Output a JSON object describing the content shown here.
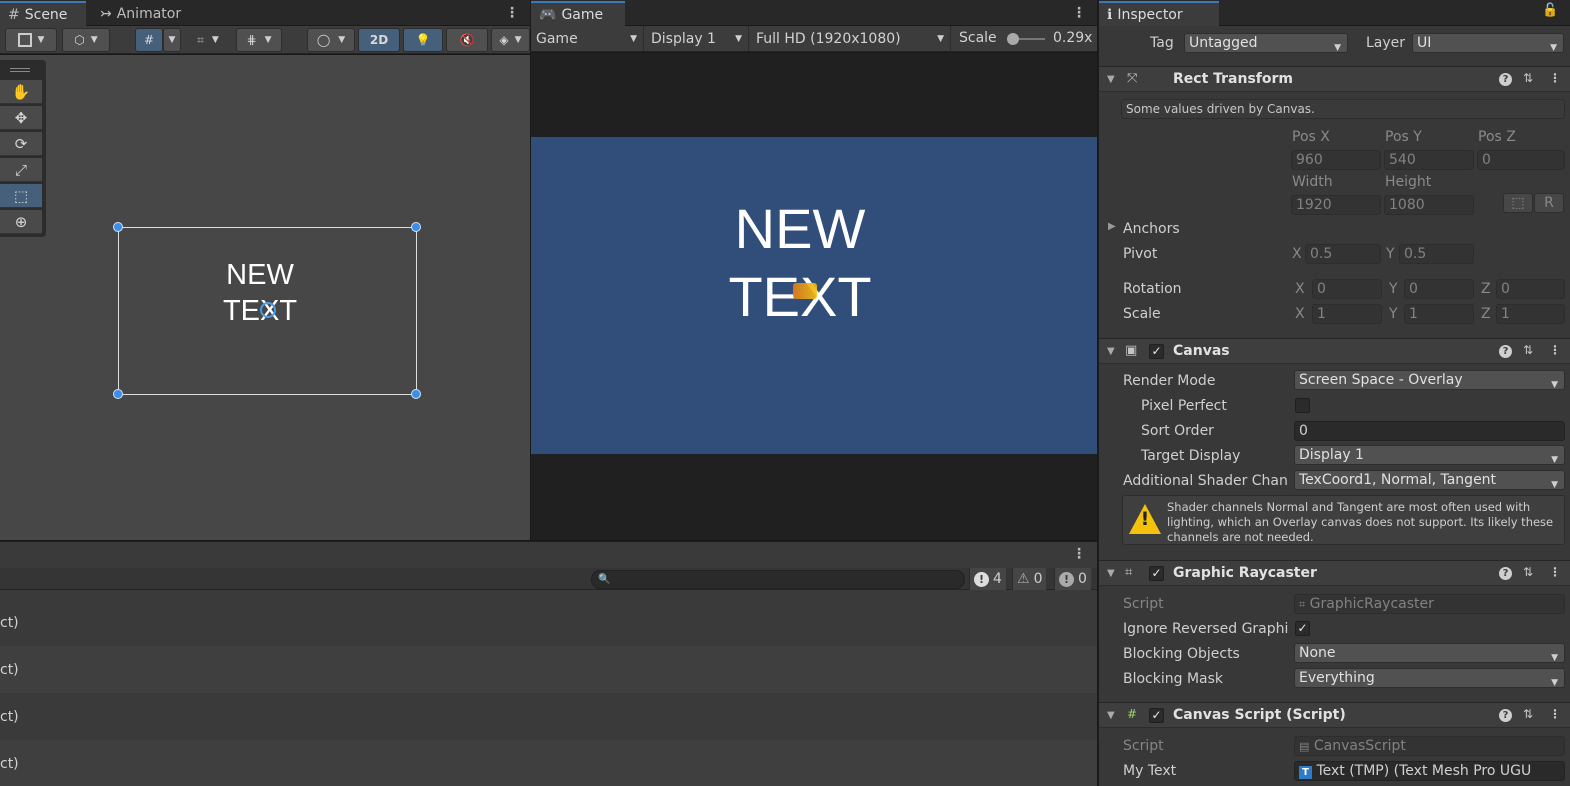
{
  "scene_tabs": {
    "scene": "Scene",
    "animator": "Animator"
  },
  "scene_toolbar": {
    "mode_2d": "2D"
  },
  "scene": {
    "text_line1": "NEW",
    "text_line2": "TEXT"
  },
  "game": {
    "tab": "Game",
    "view_dropdown": "Game",
    "display_dropdown": "Display 1",
    "resolution_dropdown": "Full HD (1920x1080)",
    "scale_label": "Scale",
    "scale_value": "0.29x",
    "text_line1": "NEW",
    "text_line2": "TEXT"
  },
  "console": {
    "error_count": "4",
    "warning_count": "0",
    "info_count": "0",
    "rows": [
      "ct)",
      "ct)",
      "ct)",
      "ct)"
    ]
  },
  "inspector": {
    "tab": "Inspector",
    "tag_label": "Tag",
    "tag_value": "Untagged",
    "layer_label": "Layer",
    "layer_value": "UI",
    "rect_transform": {
      "title": "Rect Transform",
      "note": "Some values driven by Canvas.",
      "pos_x_label": "Pos X",
      "pos_y_label": "Pos Y",
      "pos_z_label": "Pos Z",
      "pos_x": "960",
      "pos_y": "540",
      "pos_z": "0",
      "width_label": "Width",
      "height_label": "Height",
      "width": "1920",
      "height": "1080",
      "r_button": "R",
      "anchors_label": "Anchors",
      "pivot_label": "Pivot",
      "pivot_x": "0.5",
      "pivot_y": "0.5",
      "rotation_label": "Rotation",
      "rot_x": "0",
      "rot_y": "0",
      "rot_z": "0",
      "scale_label": "Scale",
      "scale_x": "1",
      "scale_y": "1",
      "scale_z": "1",
      "x": "X",
      "y": "Y",
      "z": "Z"
    },
    "canvas": {
      "title": "Canvas",
      "render_mode_label": "Render Mode",
      "render_mode": "Screen Space - Overlay",
      "pixel_perfect_label": "Pixel Perfect",
      "sort_order_label": "Sort Order",
      "sort_order": "0",
      "target_display_label": "Target Display",
      "target_display": "Display 1",
      "shader_channels_label": "Additional Shader Chan",
      "shader_channels": "TexCoord1, Normal, Tangent",
      "warning": "Shader channels Normal and Tangent are most often used with lighting, which an Overlay canvas does not support. Its likely these channels are not needed."
    },
    "graphic_raycaster": {
      "title": "Graphic Raycaster",
      "script_label": "Script",
      "script": "GraphicRaycaster",
      "ignore_reversed_label": "Ignore Reversed Graphi",
      "blocking_objects_label": "Blocking Objects",
      "blocking_objects": "None",
      "blocking_mask_label": "Blocking Mask",
      "blocking_mask": "Everything"
    },
    "canvas_script": {
      "title": "Canvas Script (Script)",
      "script_label": "Script",
      "script": "CanvasScript",
      "my_text_label": "My Text",
      "my_text": "Text (TMP) (Text Mesh Pro UGU"
    }
  }
}
